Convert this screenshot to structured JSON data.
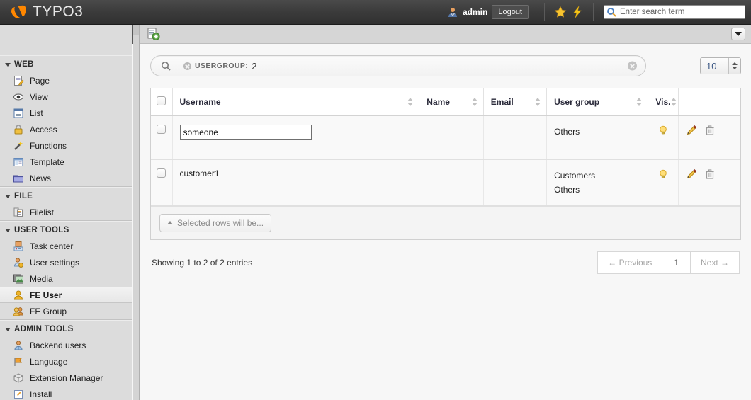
{
  "topbar": {
    "logo_text": "TYPO3",
    "logo_icon": "typo3-logo-icon",
    "user_icon": "user-avatar-icon",
    "username": "admin",
    "logout_label": "Logout",
    "bookmark_icon": "star-icon",
    "clear_cache_icon": "lightning-bolt-icon",
    "search_icon": "search-icon",
    "search_placeholder": "Enter search term",
    "search_value": ""
  },
  "sidebar": {
    "groups": [
      {
        "title": "WEB",
        "items": [
          {
            "label": "Page",
            "icon": "page-icon"
          },
          {
            "label": "View",
            "icon": "eye-icon"
          },
          {
            "label": "List",
            "icon": "list-icon"
          },
          {
            "label": "Access",
            "icon": "lock-icon"
          },
          {
            "label": "Functions",
            "icon": "wand-icon"
          },
          {
            "label": "Template",
            "icon": "template-icon"
          },
          {
            "label": "News",
            "icon": "folder-icon"
          }
        ]
      },
      {
        "title": "FILE",
        "items": [
          {
            "label": "Filelist",
            "icon": "filelist-icon"
          }
        ]
      },
      {
        "title": "USER TOOLS",
        "items": [
          {
            "label": "Task center",
            "icon": "task-center-icon"
          },
          {
            "label": "User settings",
            "icon": "user-settings-icon"
          },
          {
            "label": "Media",
            "icon": "media-icon"
          },
          {
            "label": "FE User",
            "icon": "fe-user-icon",
            "active": true
          },
          {
            "label": "FE Group",
            "icon": "fe-group-icon"
          }
        ]
      },
      {
        "title": "ADMIN TOOLS",
        "items": [
          {
            "label": "Backend users",
            "icon": "backend-users-icon"
          },
          {
            "label": "Language",
            "icon": "language-flag-icon"
          },
          {
            "label": "Extension Manager",
            "icon": "extension-manager-icon"
          },
          {
            "label": "Install",
            "icon": "install-icon"
          }
        ]
      }
    ]
  },
  "docheader": {
    "new_record_icon": "new-record-icon",
    "menu_icon": "chevron-down-icon"
  },
  "filter": {
    "search_icon": "search-icon",
    "tag_remove_icon": "remove-circle-icon",
    "tag_label": "USERGROUP:",
    "tag_value": "2",
    "clear_icon": "clear-circle-icon",
    "page_size": "10"
  },
  "table": {
    "select_all_icon": "checkbox-icon",
    "columns": [
      {
        "label": "Username",
        "sortable": true
      },
      {
        "label": "Name",
        "sortable": true
      },
      {
        "label": "Email",
        "sortable": true
      },
      {
        "label": "User group",
        "sortable": true
      },
      {
        "label": "Vis.",
        "sortable": true
      },
      {
        "label": "",
        "sortable": false
      }
    ],
    "rows": [
      {
        "username": "someone",
        "username_editing": true,
        "name": "",
        "email": "",
        "user_groups": [
          "Others"
        ],
        "visibility_icon": "lightbulb-icon",
        "edit_icon": "pencil-icon",
        "delete_icon": "trash-icon"
      },
      {
        "username": "customer1",
        "username_editing": false,
        "name": "",
        "email": "",
        "user_groups": [
          "Customers",
          "Others"
        ],
        "visibility_icon": "lightbulb-icon",
        "edit_icon": "pencil-icon",
        "delete_icon": "trash-icon"
      }
    ],
    "bulk_action_label": "Selected rows will be...",
    "bulk_caret_icon": "caret-up-icon"
  },
  "footer": {
    "showing_text": "Showing 1 to 2 of 2 entries",
    "previous_label": "← Previous",
    "page_label": "1",
    "next_label": "Next →"
  },
  "colors": {
    "brand_orange": "#ff8700",
    "topbar_dark": "#3b3b3b",
    "grey_band": "#585858",
    "sidebar_bg": "#dcdcdc",
    "content_bg": "#f7f7f7"
  }
}
